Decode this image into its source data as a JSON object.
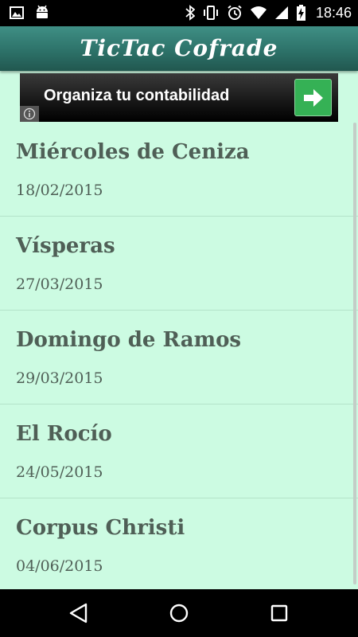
{
  "status_bar": {
    "time": "18:46",
    "icons": [
      "image-icon",
      "android-icon",
      "bluetooth-icon",
      "vibrate-icon",
      "alarm-icon",
      "wifi-icon",
      "signal-icon",
      "battery-charging-icon"
    ]
  },
  "app_bar": {
    "title": "TicTac Cofrade"
  },
  "ad": {
    "text": "Organiza tu contabilidad",
    "button_icon": "arrow-right-icon",
    "info_icon": "info-icon"
  },
  "events": [
    {
      "name": "Miércoles de Ceniza",
      "date": "18/02/2015"
    },
    {
      "name": "Vísperas",
      "date": "27/03/2015"
    },
    {
      "name": "Domingo de Ramos",
      "date": "29/03/2015"
    },
    {
      "name": "El Rocío",
      "date": "24/05/2015"
    },
    {
      "name": "Corpus Christi",
      "date": "04/06/2015"
    }
  ],
  "nav_bar": {
    "icons": [
      "back-icon",
      "home-icon",
      "recents-icon"
    ]
  },
  "colors": {
    "app_bar": "#2d7269",
    "background": "#ccfbe2",
    "text": "#4f5f56",
    "ad_button": "#35b155"
  }
}
